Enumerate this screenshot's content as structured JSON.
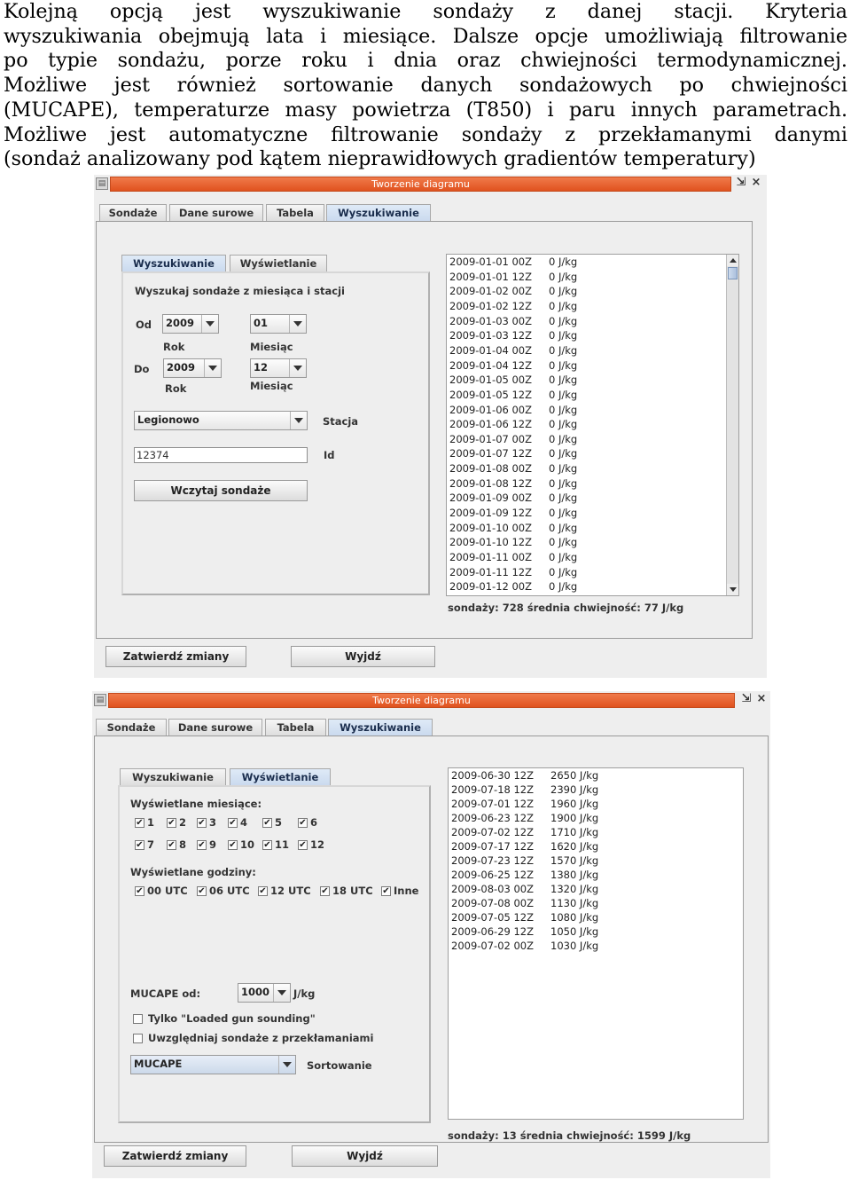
{
  "intro": {
    "lines": [
      "Kolejną opcją jest wyszukiwanie sondaży z danej stacji. Kryteria",
      "wyszukiwania obejmują lata i miesiące. Dalsze opcje umożliwiają filtrowanie",
      "po typie sondażu, porze roku i dnia oraz chwiejności termodynamicznej.",
      "Możliwe jest również sortowanie danych sondażowych po chwiejności",
      "(MUCAPE), temperaturze masy powietrza (T850) i paru innych parametrach.",
      "Możliwe jest automatyczne filtrowanie sondaży z przekłamanymi danymi",
      "(sondaż analizowany pod kątem nieprawidłowych gradientów temperatury)"
    ]
  },
  "window1": {
    "title": "Tworzenie diagramu",
    "main_tabs": [
      "Sondaże",
      "Dane surowe",
      "Tabela",
      "Wyszukiwanie"
    ],
    "sub_tabs": [
      "Wyszukiwanie",
      "Wyświetlanie"
    ],
    "search": {
      "heading": "Wyszukaj sondaże z miesiąca i stacji",
      "from_label": "Od",
      "to_label": "Do",
      "from_year": "2009",
      "from_month": "01",
      "to_year": "2009",
      "to_month": "12",
      "year_label": "Rok",
      "month_label": "Miesiąc",
      "station": "Legionowo",
      "station_label": "Stacja",
      "id_value": "12374",
      "id_label": "Id",
      "load_button": "Wczytaj sondaże"
    },
    "results": [
      {
        "date": "2009-01-01 00Z",
        "value": "0 J/kg"
      },
      {
        "date": "2009-01-01 12Z",
        "value": "0 J/kg"
      },
      {
        "date": "2009-01-02 00Z",
        "value": "0 J/kg"
      },
      {
        "date": "2009-01-02 12Z",
        "value": "0 J/kg"
      },
      {
        "date": "2009-01-03 00Z",
        "value": "0 J/kg"
      },
      {
        "date": "2009-01-03 12Z",
        "value": "0 J/kg"
      },
      {
        "date": "2009-01-04 00Z",
        "value": "0 J/kg"
      },
      {
        "date": "2009-01-04 12Z",
        "value": "0 J/kg"
      },
      {
        "date": "2009-01-05 00Z",
        "value": "0 J/kg"
      },
      {
        "date": "2009-01-05 12Z",
        "value": "0 J/kg"
      },
      {
        "date": "2009-01-06 00Z",
        "value": "0 J/kg"
      },
      {
        "date": "2009-01-06 12Z",
        "value": "0 J/kg"
      },
      {
        "date": "2009-01-07 00Z",
        "value": "0 J/kg"
      },
      {
        "date": "2009-01-07 12Z",
        "value": "0 J/kg"
      },
      {
        "date": "2009-01-08 00Z",
        "value": "0 J/kg"
      },
      {
        "date": "2009-01-08 12Z",
        "value": "0 J/kg"
      },
      {
        "date": "2009-01-09 00Z",
        "value": "0 J/kg"
      },
      {
        "date": "2009-01-09 12Z",
        "value": "0 J/kg"
      },
      {
        "date": "2009-01-10 00Z",
        "value": "0 J/kg"
      },
      {
        "date": "2009-01-10 12Z",
        "value": "0 J/kg"
      },
      {
        "date": "2009-01-11 00Z",
        "value": "0 J/kg"
      },
      {
        "date": "2009-01-11 12Z",
        "value": "0 J/kg"
      },
      {
        "date": "2009-01-12 00Z",
        "value": "0 J/kg"
      }
    ],
    "summary": "sondaży: 728 średnia chwiejność: 77 J/kg",
    "confirm_button": "Zatwierdź zmiany",
    "exit_button": "Wyjdź"
  },
  "window2": {
    "title": "Tworzenie diagramu",
    "main_tabs": [
      "Sondaże",
      "Dane surowe",
      "Tabela",
      "Wyszukiwanie"
    ],
    "sub_tabs": [
      "Wyszukiwanie",
      "Wyświetlanie"
    ],
    "display": {
      "months_heading": "Wyświetlane miesiące:",
      "months": [
        "1",
        "2",
        "3",
        "4",
        "5",
        "6",
        "7",
        "8",
        "9",
        "10",
        "11",
        "12"
      ],
      "hours_heading": "Wyświetlane godziny:",
      "hours": [
        "00 UTC",
        "06 UTC",
        "12 UTC",
        "18 UTC",
        "Inne"
      ],
      "check_mark": "✔",
      "mucape_label": "MUCAPE od:",
      "mucape_value": "1000",
      "mucape_unit": "J/kg",
      "loaded_gun": "Tylko \"Loaded gun sounding\"",
      "include_errors": "Uwzględniaj sondaże z przekłamaniami",
      "sort_value": "MUCAPE",
      "sort_label": "Sortowanie"
    },
    "results": [
      {
        "date": "2009-06-30 12Z",
        "value": "2650 J/kg"
      },
      {
        "date": "2009-07-18 12Z",
        "value": "2390 J/kg"
      },
      {
        "date": "2009-07-01 12Z",
        "value": "1960 J/kg"
      },
      {
        "date": "2009-06-23 12Z",
        "value": "1900 J/kg"
      },
      {
        "date": "2009-07-02 12Z",
        "value": "1710 J/kg"
      },
      {
        "date": "2009-07-17 12Z",
        "value": "1620 J/kg"
      },
      {
        "date": "2009-07-23 12Z",
        "value": "1570 J/kg"
      },
      {
        "date": "2009-06-25 12Z",
        "value": "1380 J/kg"
      },
      {
        "date": "2009-08-03 00Z",
        "value": "1320 J/kg"
      },
      {
        "date": "2009-07-08 00Z",
        "value": "1130 J/kg"
      },
      {
        "date": "2009-07-05 12Z",
        "value": "1080 J/kg"
      },
      {
        "date": "2009-06-29 12Z",
        "value": "1050 J/kg"
      },
      {
        "date": "2009-07-02 00Z",
        "value": "1030 J/kg"
      }
    ],
    "summary": "sondaży: 13 średnia chwiejność: 1599 J/kg",
    "confirm_button": "Zatwierdź zmiany",
    "exit_button": "Wyjdź"
  },
  "icons": {
    "close": "×",
    "restore": "⇲"
  }
}
